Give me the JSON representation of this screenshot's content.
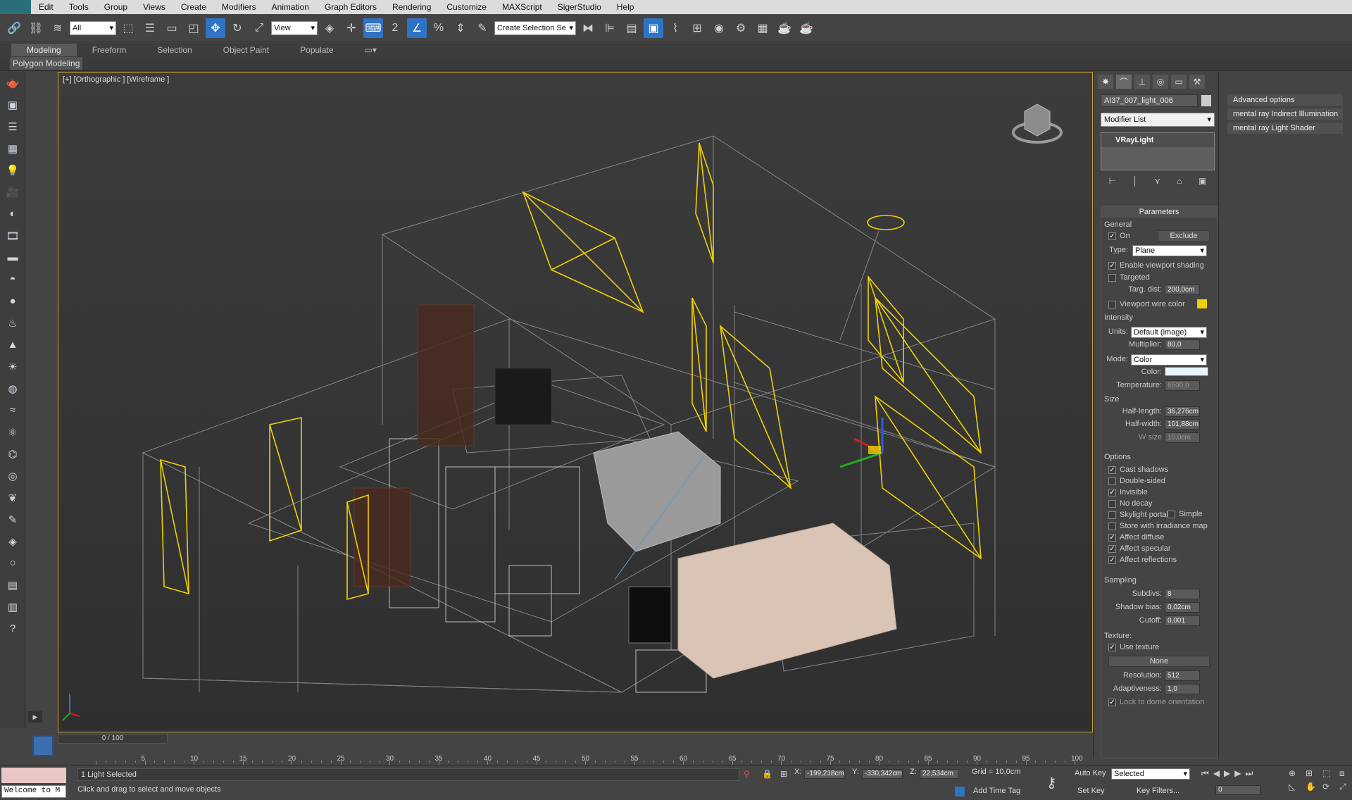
{
  "menu": [
    "Edit",
    "Tools",
    "Group",
    "Views",
    "Create",
    "Modifiers",
    "Animation",
    "Graph Editors",
    "Rendering",
    "Customize",
    "MAXScript",
    "SigerStudio",
    "Help"
  ],
  "toolbar": {
    "filter_value": "All",
    "refcoord_value": "View",
    "selection_set_placeholder": "Create Selection Se"
  },
  "ribbon": {
    "tabs": [
      "Modeling",
      "Freeform",
      "Selection",
      "Object Paint",
      "Populate"
    ],
    "active_tab": "Modeling",
    "sub_label": "Polygon Modeling"
  },
  "viewport": {
    "label": "[+] [Orthographic ] [Wireframe ]"
  },
  "command_panel": {
    "object_name": "AI37_007_light_006",
    "modifier_list": "Modifier List",
    "stack_item": "VRayLight",
    "rollout_title": "Parameters",
    "general": {
      "title": "General",
      "on_label": "On",
      "exclude_label": "Exclude",
      "type_label": "Type:",
      "type_value": "Plane",
      "enable_viewport_shading": "Enable viewport shading",
      "targeted": "Targeted",
      "targ_dist_label": "Targ. dist:",
      "targ_dist_value": "200,0cm",
      "viewport_wire_color": "Viewport wire color"
    },
    "intensity": {
      "title": "Intensity",
      "units_label": "Units:",
      "units_value": "Default (image)",
      "multiplier_label": "Multiplier:",
      "multiplier_value": "80,0",
      "mode_label": "Mode:",
      "mode_value": "Color",
      "color_label": "Color:",
      "temperature_label": "Temperature:",
      "temperature_value": "6500,0"
    },
    "size": {
      "title": "Size",
      "half_length_label": "Half-length:",
      "half_length_value": "36,276cm",
      "half_width_label": "Half-width:",
      "half_width_value": "101,88cm",
      "w_size_label": "W size",
      "w_size_value": "10,0cm"
    },
    "options": {
      "title": "Options",
      "items": [
        "Cast shadows",
        "Double-sided",
        "Invisible",
        "No decay",
        "Skylight portal",
        "Store with irradiance map",
        "Affect diffuse",
        "Affect specular",
        "Affect reflections"
      ],
      "checked": [
        true,
        false,
        true,
        false,
        false,
        false,
        true,
        true,
        true
      ],
      "simple_label": "Simple"
    },
    "sampling": {
      "title": "Sampling",
      "subdivs_label": "Subdivs:",
      "subdivs_value": "8",
      "shadow_bias_label": "Shadow bias:",
      "shadow_bias_value": "0,02cm",
      "cutoff_label": "Cutoff:",
      "cutoff_value": "0,001"
    },
    "texture": {
      "title": "Texture:",
      "use_texture": "Use texture",
      "map_button": "None",
      "resolution_label": "Resolution:",
      "resolution_value": "512",
      "adaptiveness_label": "Adaptiveness:",
      "adaptiveness_value": "1,0",
      "lock_dome": "Lock to dome orientation"
    }
  },
  "right_panel": [
    "Advanced options",
    "mental ray Indirect Illumination",
    "mental ray Light Shader"
  ],
  "timeline": {
    "slider": "0 / 100",
    "ticks": [
      "5",
      "10",
      "15",
      "20",
      "25",
      "30",
      "35",
      "40",
      "45",
      "50",
      "55",
      "60",
      "65",
      "70",
      "75",
      "80",
      "85",
      "90",
      "95",
      "100"
    ]
  },
  "status": {
    "maxscript": "Welcome to M",
    "selected": "1 Light Selected",
    "prompt": "Click and drag to select and move objects",
    "x_label": "X:",
    "x_value": "-199,218cm",
    "y_label": "Y:",
    "y_value": "-330,342cm",
    "z_label": "Z:",
    "z_value": "22,534cm",
    "grid": "Grid = 10,0cm",
    "add_time_tag": "Add Time Tag",
    "auto_key": "Auto Key",
    "set_key": "Set Key",
    "selected_dropdown": "Selected",
    "key_filters": "Key Filters...",
    "frame": "0"
  },
  "colors": {
    "light_wire": "#f0d000",
    "selection_border": "#c9a227",
    "accent": "#2e73c5"
  }
}
